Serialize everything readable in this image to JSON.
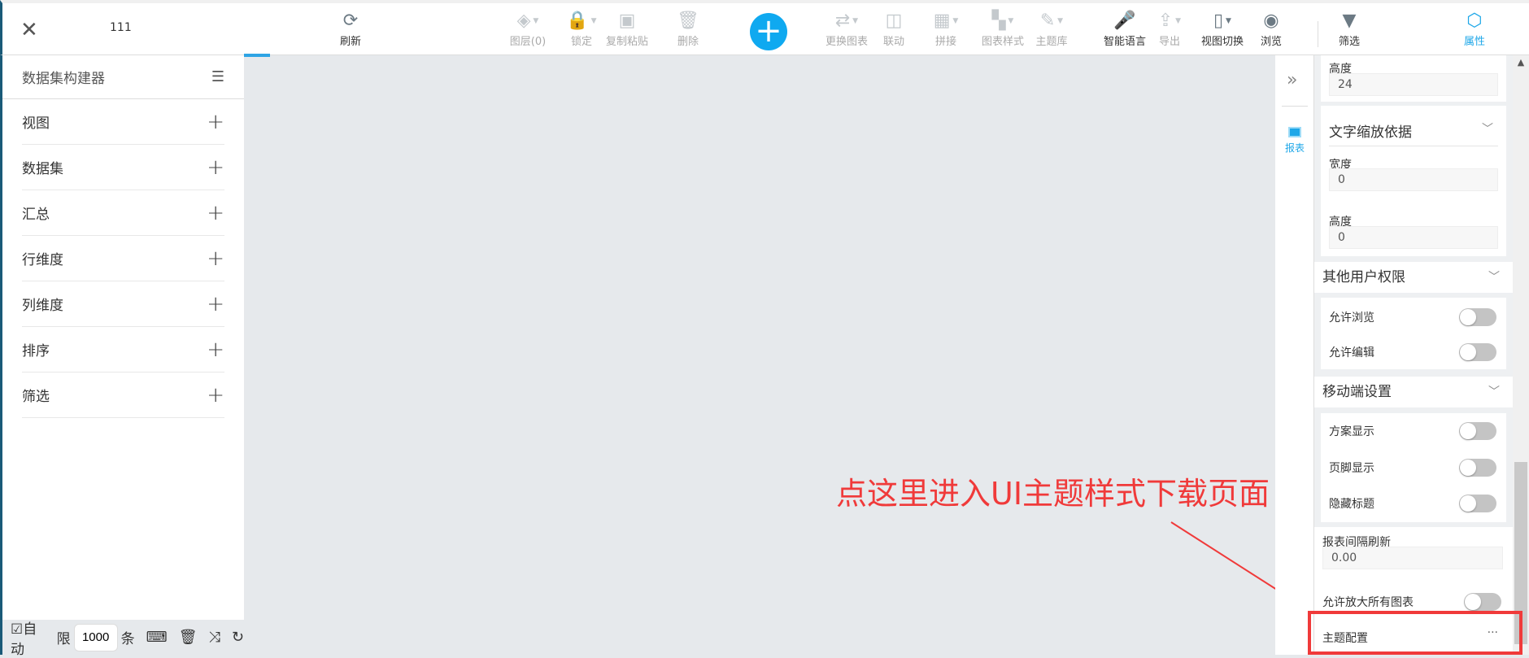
{
  "header": {
    "title": "111"
  },
  "toolbar": [
    {
      "label": "刷新",
      "icon": "refresh-icon",
      "state": "normal"
    },
    {
      "label": "图层(0)",
      "icon": "layers-icon",
      "state": "disabled"
    },
    {
      "label": "锁定",
      "icon": "lock-icon",
      "state": "disabled"
    },
    {
      "label": "复制粘贴",
      "icon": "copy-icon",
      "state": "disabled"
    },
    {
      "label": "删除",
      "icon": "trash-icon",
      "state": "disabled"
    },
    {
      "label": "更换图表",
      "icon": "swap-chart-icon",
      "state": "disabled"
    },
    {
      "label": "联动",
      "icon": "link-icon",
      "state": "disabled"
    },
    {
      "label": "拼接",
      "icon": "merge-icon",
      "state": "disabled"
    },
    {
      "label": "图表样式",
      "icon": "chart-style-icon",
      "state": "disabled"
    },
    {
      "label": "主题库",
      "icon": "brush-icon",
      "state": "disabled"
    },
    {
      "label": "智能语言",
      "icon": "microphone-icon",
      "state": "normal"
    },
    {
      "label": "导出",
      "icon": "export-icon",
      "state": "disabled"
    },
    {
      "label": "视图切换",
      "icon": "phone-icon",
      "state": "normal"
    },
    {
      "label": "浏览",
      "icon": "eye-icon",
      "state": "normal"
    },
    {
      "label": "筛选",
      "icon": "filter-icon",
      "state": "normal"
    },
    {
      "label": "属性",
      "icon": "hexagon-icon",
      "state": "active"
    }
  ],
  "sidebar": {
    "title": "数据集构建器",
    "items": [
      "视图",
      "数据集",
      "汇总",
      "行维度",
      "列维度",
      "排序",
      "筛选"
    ]
  },
  "bottom": {
    "auto_label": "☑自动",
    "limit_label": "限",
    "limit_value": "1000",
    "unit": "条"
  },
  "iconcol": {
    "report_label": "报表"
  },
  "panel": {
    "height_label": "高度",
    "height_value": "24",
    "text_scale": {
      "title": "文字缩放依据",
      "width_label": "宽度",
      "width_value": "0",
      "height_label": "高度",
      "height_value": "0"
    },
    "permissions": {
      "title": "其他用户权限",
      "allow_view": "允许浏览",
      "allow_edit": "允许编辑"
    },
    "mobile": {
      "title": "移动端设置",
      "plan_display": "方案显示",
      "footer_display": "页脚显示",
      "hide_title": "隐藏标题"
    },
    "refresh_label": "报表间隔刷新",
    "refresh_value": "0.00",
    "zoom_all": "允许放大所有图表",
    "theme_config": "主题配置",
    "more": "···"
  },
  "annotation": "点这里进入UI主题样式下载页面",
  "colors": {
    "accent": "#0fa9f0",
    "annotation": "#f03a3a"
  }
}
